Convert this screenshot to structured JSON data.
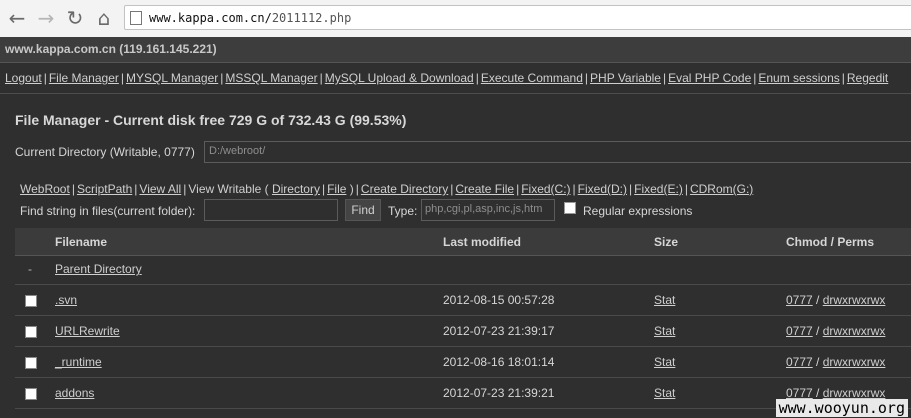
{
  "browser": {
    "url_host": "www.kappa.com.cn/",
    "url_path": "2011112.php",
    "back_icon": "←",
    "forward_icon": "→",
    "reload_icon": "↻",
    "home_icon": "⌂"
  },
  "host_info": "www.kappa.com.cn (119.161.145.221)",
  "menu": {
    "items": [
      "Logout",
      "File Manager",
      "MYSQL Manager",
      "MSSQL Manager",
      "MySQL Upload & Download",
      "Execute Command",
      "PHP Variable",
      "Eval PHP Code",
      "Enum sessions",
      "Regedit"
    ]
  },
  "page_title": "File Manager - Current disk free 729 G of 732.43 G (99.53%)",
  "current_dir": {
    "label": "Current Directory (Writable, 0777)",
    "value": "D:/webroot/"
  },
  "links": {
    "webroot": "WebRoot",
    "scriptpath": "ScriptPath",
    "view_all": "View All",
    "view_writable": "View Writable (",
    "directory": "Directory",
    "file": "File",
    "close_paren": ")",
    "create_dir": "Create Directory",
    "create_file": "Create File",
    "drives": [
      "Fixed(C:)",
      "Fixed(D:)",
      "Fixed(E:)",
      "CDRom(G:)"
    ]
  },
  "find": {
    "label": "Find string in files(current folder):",
    "button": "Find",
    "type_label": "Type:",
    "type_value": "php,cgi,pl,asp,inc,js,htm",
    "regex_label": "Regular expressions"
  },
  "table": {
    "headers": {
      "filename": "Filename",
      "modified": "Last modified",
      "size": "Size",
      "chmod": "Chmod / Perms"
    },
    "parent": {
      "dash": "-",
      "label": "Parent Directory"
    },
    "rows": [
      {
        "name": ".svn",
        "modified": "2012-08-15 00:57:28",
        "size": "Stat",
        "chmod": "0777",
        "perms": "drwxrwxrwx"
      },
      {
        "name": "URLRewrite",
        "modified": "2012-07-23 21:39:17",
        "size": "Stat",
        "chmod": "0777",
        "perms": "drwxrwxrwx"
      },
      {
        "name": "_runtime",
        "modified": "2012-08-16 18:01:14",
        "size": "Stat",
        "chmod": "0777",
        "perms": "drwxrwxrwx"
      },
      {
        "name": "addons",
        "modified": "2012-07-23 21:39:21",
        "size": "Stat",
        "chmod": "0777",
        "perms": "drwxrwxrwx"
      }
    ]
  },
  "watermark": "www.wooyun.org"
}
